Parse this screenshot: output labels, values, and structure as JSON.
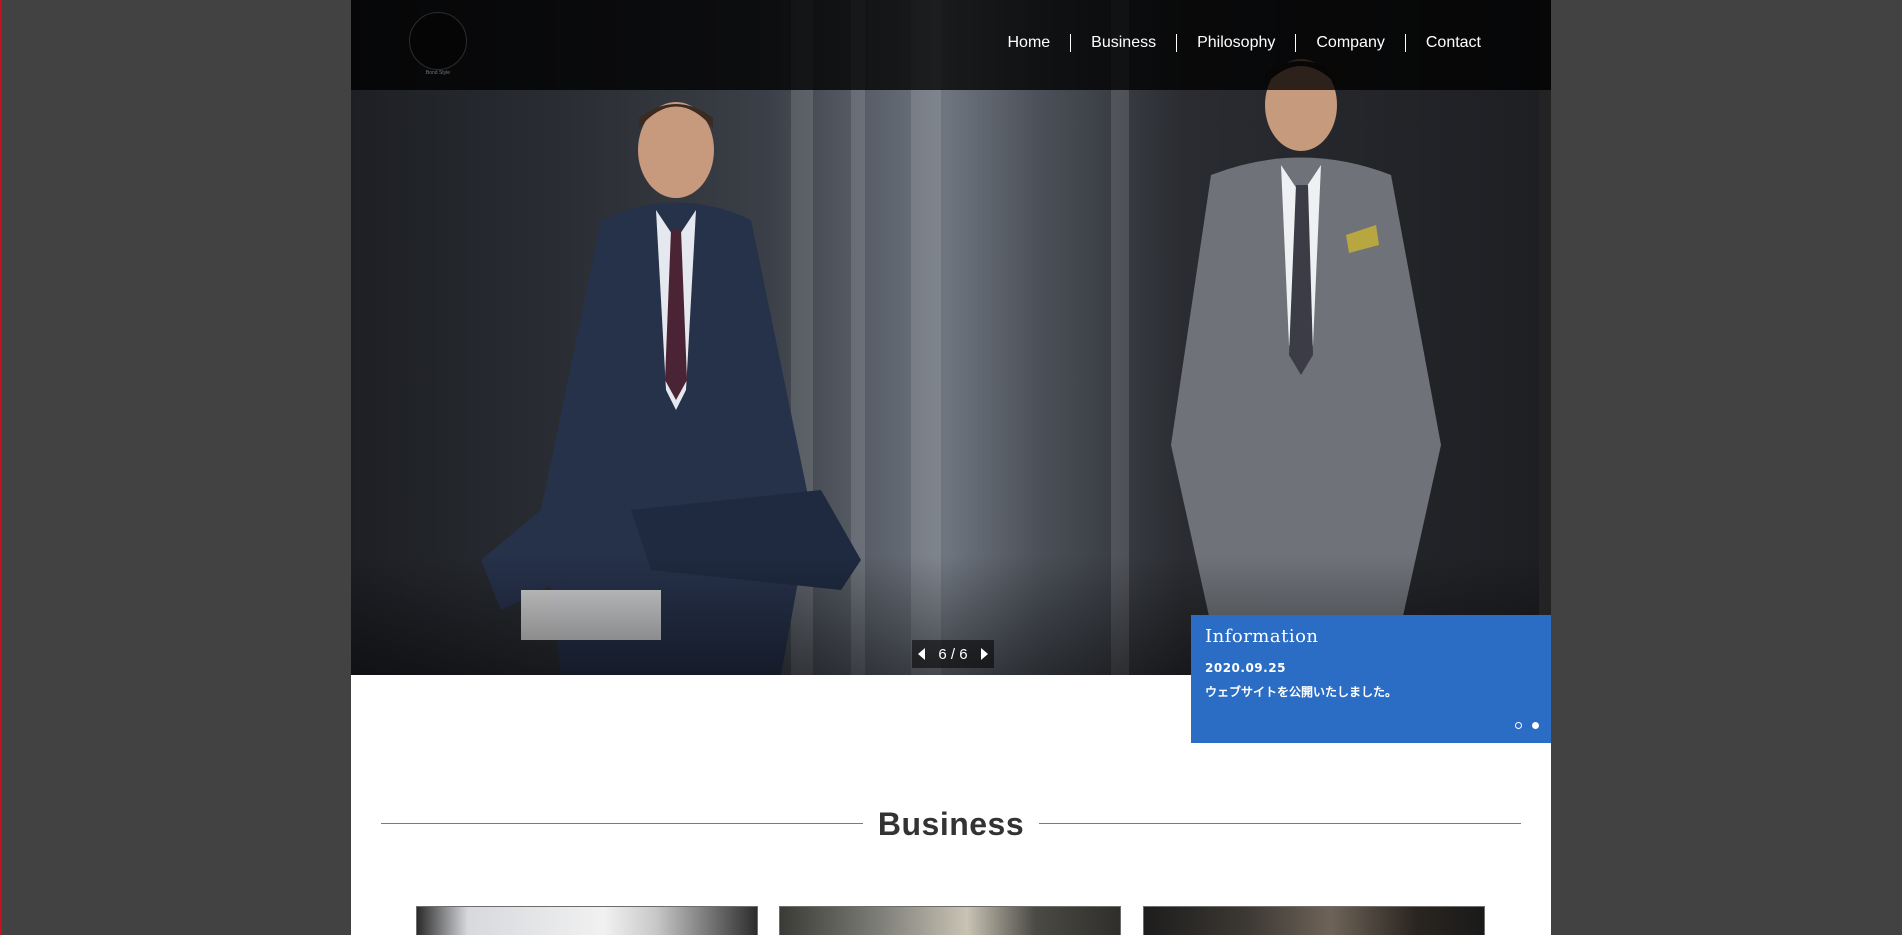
{
  "header": {
    "logo_text": "Bond Style",
    "nav": [
      "Home",
      "Business",
      "Philosophy",
      "Company",
      "Contact"
    ]
  },
  "slider": {
    "pager_text": "6 / 6"
  },
  "information": {
    "title": "Information",
    "date": "2020.09.25",
    "text": "ウェブサイトを公開いたしました。",
    "dots": [
      false,
      true
    ]
  },
  "sections": {
    "business_title": "Business"
  },
  "colors": {
    "accent_blue": "#2b6cc4",
    "backdrop": "#424242",
    "edge_red": "#c1121f"
  }
}
